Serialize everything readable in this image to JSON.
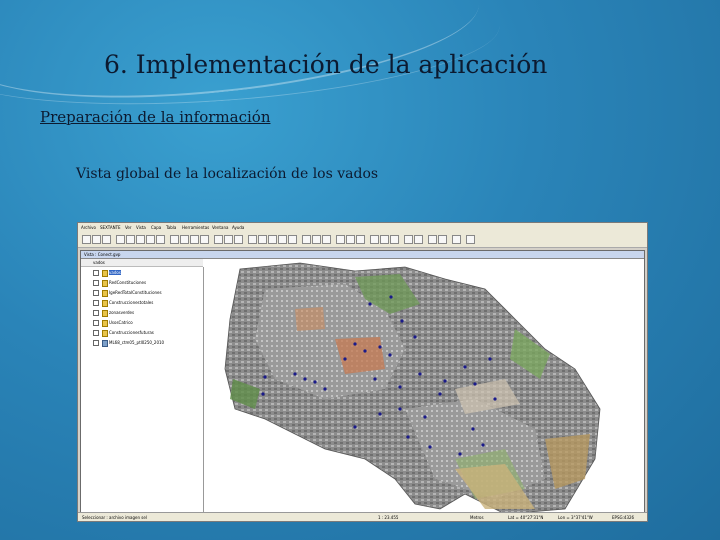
{
  "slide": {
    "title": "6. Implementación de la aplicación",
    "subtitle": "Preparación de la información",
    "caption": "Vista global de la localización de los vados"
  },
  "app": {
    "menu": [
      "Archivo",
      "SEXTANTE",
      "Ver",
      "Vista",
      "Capa",
      "Tabla",
      "Herramientas",
      "Ventana",
      "Ayuda"
    ],
    "view_title": "Vista : Conect.gvp",
    "scale_value": "vados",
    "layers": [
      {
        "label": "vados",
        "checked": true,
        "selected": true
      },
      {
        "label": "RedConstituciones",
        "checked": true,
        "selected": false
      },
      {
        "label": "IgeRedTotalConstituciones",
        "checked": true,
        "selected": false
      },
      {
        "label": "Construccionestotales",
        "checked": true,
        "selected": false
      },
      {
        "label": "zonasverdes",
        "checked": true,
        "selected": false
      },
      {
        "label": "UsosCatrico",
        "checked": true,
        "selected": false
      },
      {
        "label": "Construccionesfuturas",
        "checked": true,
        "selected": false
      },
      {
        "label": "ML68_ctm05_ptl0250_2010",
        "checked": true,
        "selected": false
      }
    ],
    "status": {
      "left": "Seleccionar : archivo imagen sel",
      "scale": "1 : 23.455",
      "units": "Metros",
      "x": "Lat = 40°27'31\"N",
      "y": "Lon = 3°37'41\"W",
      "epsg": "EPSG:4326"
    },
    "colors": {
      "accent": "#3166c5",
      "points": "#1a1a8a"
    }
  }
}
